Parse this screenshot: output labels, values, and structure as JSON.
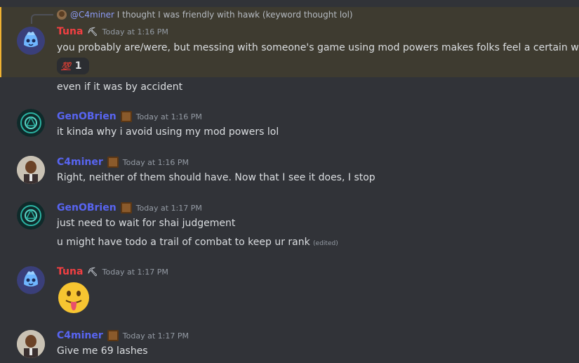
{
  "colors": {
    "background": "#313338",
    "highlight_bg": "#3e3b30",
    "highlight_border": "#f0b232",
    "tuna": "#f23f42",
    "blue_user": "#5865f2",
    "text": "#dbdee1",
    "muted": "#949ba4"
  },
  "reply": {
    "mention": "@C4miner",
    "text": "I thought I was friendly with hawk (keyword thought lol)"
  },
  "messages": [
    {
      "author": "Tuna",
      "time": "Today at 1:16 PM",
      "lines": [
        "you probably are/were, but messing with someone's game using mod powers makes folks feel a certain way"
      ],
      "reaction": {
        "emoji": "💯",
        "count": "1"
      }
    },
    {
      "continuation": "even if it was by accident"
    },
    {
      "author": "GenOBrien",
      "time": "Today at 1:16 PM",
      "lines": [
        "it kinda why i avoid using my mod powers lol"
      ]
    },
    {
      "author": "C4miner",
      "time": "Today at 1:16 PM",
      "lines": [
        "Right, neither of them should have.  Now that I see it does, I stop"
      ]
    },
    {
      "author": "GenOBrien",
      "time": "Today at 1:17 PM",
      "lines": [
        "just need to wait for shai judgement",
        "u might have todo a trail of combat to keep ur rank"
      ],
      "edited": "(edited)"
    },
    {
      "author": "Tuna",
      "time": "Today at 1:17 PM",
      "emoji": "😛"
    },
    {
      "author": "C4miner",
      "time": "Today at 1:17 PM",
      "lines": [
        "Give me 69 lashes"
      ]
    }
  ]
}
